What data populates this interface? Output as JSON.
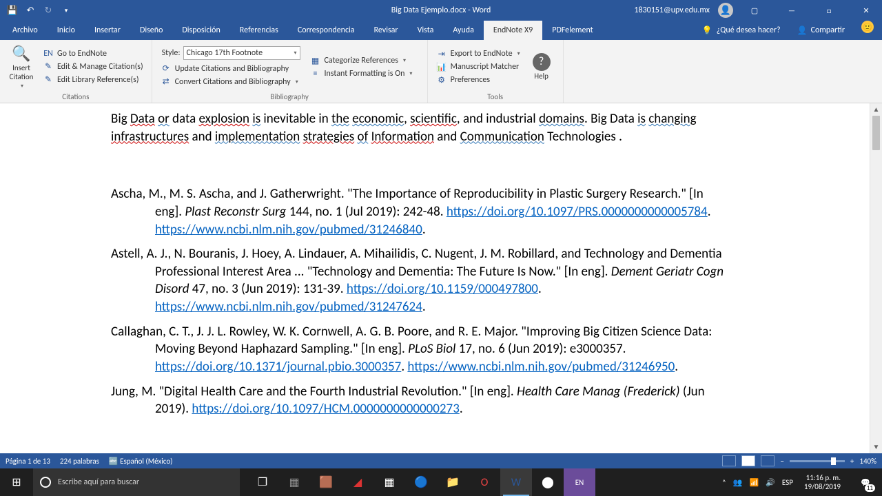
{
  "titlebar": {
    "doc_title": "Big Data Ejemplo.docx - Word",
    "user_email": "1830151@upv.edu.mx"
  },
  "tabs": {
    "items": [
      "Archivo",
      "Inicio",
      "Insertar",
      "Diseño",
      "Disposición",
      "Referencias",
      "Correspondencia",
      "Revisar",
      "Vista",
      "Ayuda",
      "EndNote X9",
      "PDFelement"
    ],
    "active_index": 10,
    "tell_me": "¿Qué desea hacer?",
    "share": "Compartir"
  },
  "ribbon": {
    "citations": {
      "insert": "Insert Citation",
      "go_endnote": "Go to EndNote",
      "edit_manage": "Edit & Manage Citation(s)",
      "edit_library": "Edit Library Reference(s)",
      "label": "Citations"
    },
    "bibliography": {
      "style_label": "Style:",
      "style_value": "Chicago 17th Footnote",
      "update": "Update Citations and Bibliography",
      "convert": "Convert Citations and Bibliography",
      "categorize": "Categorize References",
      "instant": "Instant Formatting is On",
      "label": "Bibliography"
    },
    "tools": {
      "export": "Export to EndNote",
      "matcher": "Manuscript Matcher",
      "prefs": "Preferences",
      "help": "Help",
      "label": "Tools"
    }
  },
  "document": {
    "intro_parts": [
      "Big ",
      "Data",
      " ",
      "or",
      " data ",
      "explosion",
      " ",
      "is",
      " inevitable in ",
      "the",
      " ",
      "economic",
      ", ",
      "scientific",
      ", and industrial ",
      "domains",
      ". Big Data ",
      "is",
      " ",
      "changing",
      " ",
      "infrastructures",
      " and ",
      "implementation",
      " ",
      "strategies",
      " ",
      "of",
      " ",
      "Information",
      " and ",
      "Communication",
      " Technologies ."
    ],
    "refs": [
      {
        "text_before": "Ascha, M., M. S. Ascha, and J. Gatherwright. \"The Importance of Reproducibility in Plastic Surgery Research.\" [In eng]. ",
        "journal": "Plast Reconstr Surg",
        "after_journal": " 144, no. 1 (Jul 2019): 242-48. ",
        "links": [
          "https://doi.org/10.1097/PRS.0000000000005784",
          "https://www.ncbi.nlm.nih.gov/pubmed/31246840"
        ]
      },
      {
        "text_before": "Astell, A. J., N. Bouranis, J. Hoey, A. Lindauer, A. Mihailidis, C. Nugent, J. M. Robillard, and Technology and Dementia Professional Interest Area ... \"Technology and Dementia: The Future Is Now.\" [In eng]. ",
        "journal": "Dement Geriatr Cogn Disord",
        "after_journal": " 47, no. 3 (Jun 2019): 131-39. ",
        "links": [
          "https://doi.org/10.1159/000497800",
          "https://www.ncbi.nlm.nih.gov/pubmed/31247624"
        ]
      },
      {
        "text_before": "Callaghan, C. T., J. J. L. Rowley, W. K. Cornwell, A. G. B. Poore, and R. E. Major. \"Improving Big Citizen Science Data: Moving Beyond Haphazard Sampling.\" [In eng]. ",
        "journal": "PLoS Biol",
        "after_journal": " 17, no. 6 (Jun 2019): e3000357. ",
        "links": [
          "https://doi.org/10.1371/journal.pbio.3000357",
          "https://www.ncbi.nlm.nih.gov/pubmed/31246950"
        ]
      },
      {
        "text_before": "Jung, M. \"Digital Health Care and the Fourth Industrial Revolution.\" [In eng]. ",
        "journal": "Health Care Manag (Frederick)",
        "after_journal": "  (Jun 2019). ",
        "links": [
          "https://doi.org/10.1097/HCM.0000000000000273"
        ]
      }
    ]
  },
  "status": {
    "page": "Página 1 de 13",
    "words": "224 palabras",
    "lang": "Español (México)",
    "zoom": "140%"
  },
  "taskbar": {
    "search_placeholder": "Escribe aquí para buscar",
    "lang": "ESP",
    "time": "11:16 p. m.",
    "date": "19/08/2019",
    "notif_count": "11"
  }
}
